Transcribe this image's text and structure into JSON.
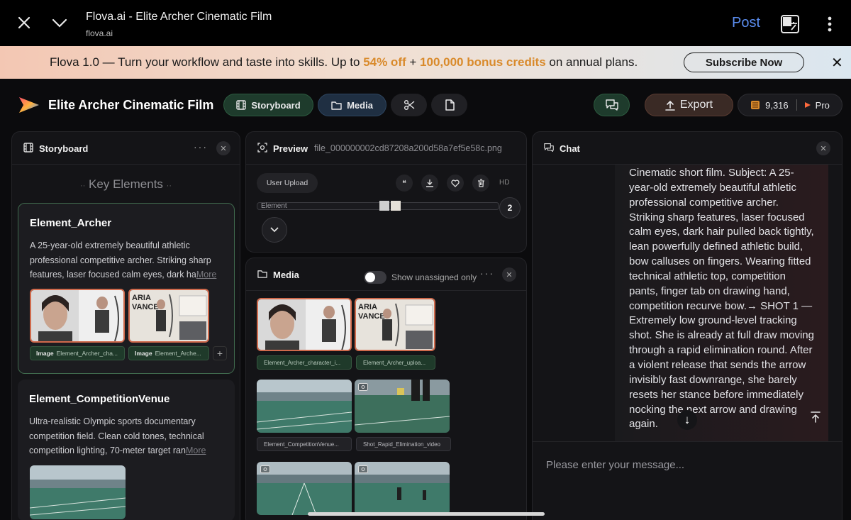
{
  "browser": {
    "title": "Flova.ai - Elite Archer Cinematic Film",
    "url": "flova.ai",
    "post_label": "Post"
  },
  "banner": {
    "text_a": "Flova 1.0 — Turn your workflow and taste into skills. Up to ",
    "discount": "54% off",
    "text_b": " + ",
    "bonus": "100,000 bonus credits",
    "text_c": " on annual plans.",
    "subscribe_label": "Subscribe Now"
  },
  "header": {
    "project_title": "Elite Archer Cinematic Film",
    "tab_storyboard": "Storyboard",
    "tab_media": "Media",
    "export_label": "Export",
    "credits": "9,316",
    "plan": "Pro"
  },
  "storyboard": {
    "title": "Storyboard",
    "section": "Key Elements",
    "more_label": "More",
    "cards": [
      {
        "title": "Element_Archer",
        "desc": "A 25-year-old extremely beautiful athletic professional competitive archer. Striking sharp features, laser focused calm eyes, dark ha",
        "tags": [
          {
            "kind": "Image",
            "name": "Element_Archer_cha..."
          },
          {
            "kind": "Image",
            "name": "Element_Arche..."
          }
        ]
      },
      {
        "title": "Element_CompetitionVenue",
        "desc": "Ultra-realistic Olympic sports documentary competition field. Clean cold tones, technical competition lighting, 70-meter target ran"
      }
    ]
  },
  "preview": {
    "title": "Preview",
    "filename": "file_000000002cd87208a200d58a7ef5e58c.png",
    "upload_label": "User Upload",
    "hd_label": "HD",
    "element_label": "Element",
    "count": "2"
  },
  "media": {
    "title": "Media",
    "toggle_label": "Show unassigned only",
    "tags": [
      "Element_Archer_character_i...",
      "Element_Archer_uploa...",
      "Element_CompetitionVenue...",
      "Shot_Rapid_Elimination_video"
    ]
  },
  "chat": {
    "title": "Chat",
    "message": "Cinematic short film. Subject: A 25-year-old extremely beautiful athletic professional competitive archer. Striking sharp features, laser focused calm eyes, dark hair pulled back tightly, lean powerfully defined athletic build, bow calluses on fingers. Wearing fitted technical athletic top, competition pants, finger tab on drawing hand, competition recurve bow.→ SHOT 1 — Extremely low ground-level tracking shot. She is already at full draw moving through a rapid elimination round. After a violent release that sends the arrow invisibly fast downrange, she barely resets her stance before immediately nocking the next arrow and drawing again.",
    "placeholder": "Please enter your message..."
  },
  "colors": {
    "accent_green": "#1e3b2c",
    "accent_blue": "#1f2f42",
    "highlight": "#d98a2b",
    "link": "#5b8def"
  }
}
